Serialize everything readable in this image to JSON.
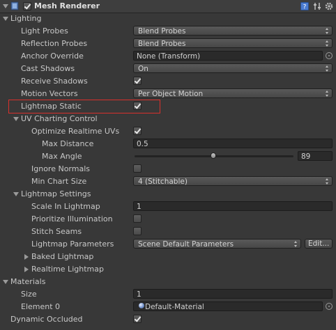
{
  "header": {
    "title": "Mesh Renderer",
    "enabled": true,
    "icons": [
      "book-help-icon",
      "preset-sliders-icon",
      "gear-icon"
    ]
  },
  "lighting": {
    "label": "Lighting",
    "light_probes": {
      "label": "Light Probes",
      "value": "Blend Probes"
    },
    "reflection_probes": {
      "label": "Reflection Probes",
      "value": "Blend Probes"
    },
    "anchor_override": {
      "label": "Anchor Override",
      "value": "None (Transform)"
    },
    "cast_shadows": {
      "label": "Cast Shadows",
      "value": "On"
    },
    "receive_shadows": {
      "label": "Receive Shadows",
      "checked": true
    },
    "motion_vectors": {
      "label": "Motion Vectors",
      "value": "Per Object Motion"
    },
    "lightmap_static": {
      "label": "Lightmap Static",
      "checked": true
    }
  },
  "uv_charting": {
    "label": "UV Charting Control",
    "optimize_realtime_uvs": {
      "label": "Optimize Realtime UVs",
      "checked": true
    },
    "max_distance": {
      "label": "Max Distance",
      "value": "0.5"
    },
    "max_angle": {
      "label": "Max Angle",
      "value": "89",
      "numeric": 89,
      "min": 0,
      "max": 180
    },
    "ignore_normals": {
      "label": "Ignore Normals",
      "checked": false
    },
    "min_chart_size": {
      "label": "Min Chart Size",
      "value": "4 (Stitchable)"
    }
  },
  "lightmap_settings": {
    "label": "Lightmap Settings",
    "scale_in_lightmap": {
      "label": "Scale In Lightmap",
      "value": "1"
    },
    "prioritize_illumination": {
      "label": "Prioritize Illumination",
      "checked": false
    },
    "stitch_seams": {
      "label": "Stitch Seams",
      "checked": false
    },
    "lightmap_parameters": {
      "label": "Lightmap Parameters",
      "value": "Scene Default Parameters",
      "edit_label": "Edit..."
    },
    "baked_lightmap": {
      "label": "Baked Lightmap"
    },
    "realtime_lightmap": {
      "label": "Realtime Lightmap"
    }
  },
  "materials": {
    "label": "Materials",
    "size": {
      "label": "Size",
      "value": "1"
    },
    "element0": {
      "label": "Element 0",
      "value": "Default-Material"
    }
  },
  "dynamic_occluded": {
    "label": "Dynamic Occluded",
    "checked": true
  },
  "colors": {
    "background": "#383838",
    "highlight": "#d9302c"
  }
}
